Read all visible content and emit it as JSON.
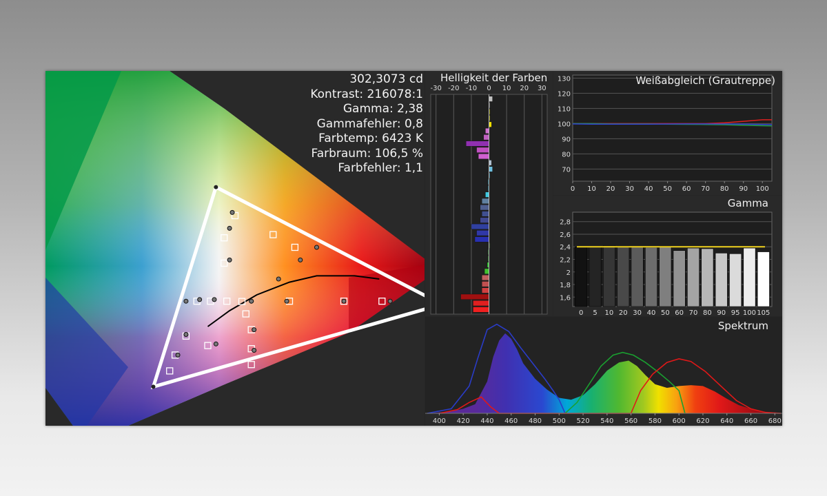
{
  "stats": {
    "luminance": "302,3073 cd",
    "contrast": "Kontrast: 216078:1",
    "gamma": "Gamma: 2,38",
    "gamma_error": "Gammafehler: 0,8",
    "color_temp": "Farbtemp: 6423 K",
    "gamut": "Farbraum: 106,5 %",
    "color_error": "Farbfehler: 1,1"
  },
  "colors": {
    "gamma_target": "#f0d21e",
    "wb_red": "#e02020",
    "wb_green": "#20a040",
    "wb_blue": "#3040d0",
    "spec_blue": "#2a3cc8",
    "spec_green": "#1aa030",
    "spec_red": "#e01818"
  },
  "chart_data": [
    {
      "type": "scatter",
      "name": "cie_gamut",
      "measured_primaries": [
        [
          0.68,
          0.32
        ],
        [
          0.265,
          0.69
        ],
        [
          0.15,
          0.06
        ]
      ],
      "reference_triangle": [
        [
          0.64,
          0.33
        ],
        [
          0.3,
          0.6
        ],
        [
          0.15,
          0.06
        ]
      ],
      "planckian_locus": [
        [
          0.565,
          0.4
        ],
        [
          0.52,
          0.41
        ],
        [
          0.45,
          0.41
        ],
        [
          0.4,
          0.39
        ],
        [
          0.34,
          0.35
        ],
        [
          0.29,
          0.3
        ],
        [
          0.25,
          0.25
        ]
      ],
      "targets": [
        [
          0.3,
          0.6
        ],
        [
          0.28,
          0.53
        ],
        [
          0.28,
          0.45
        ],
        [
          0.3127,
          0.329
        ],
        [
          0.4,
          0.33
        ],
        [
          0.5,
          0.33
        ],
        [
          0.57,
          0.33
        ],
        [
          0.41,
          0.5
        ],
        [
          0.37,
          0.54
        ],
        [
          0.23,
          0.33
        ],
        [
          0.255,
          0.33
        ],
        [
          0.285,
          0.33
        ],
        [
          0.19,
          0.16
        ],
        [
          0.21,
          0.22
        ],
        [
          0.25,
          0.19
        ],
        [
          0.32,
          0.29
        ],
        [
          0.33,
          0.24
        ],
        [
          0.33,
          0.18
        ],
        [
          0.33,
          0.13
        ],
        [
          0.18,
          0.11
        ]
      ],
      "measurements": [
        [
          0.295,
          0.61
        ],
        [
          0.29,
          0.56
        ],
        [
          0.29,
          0.46
        ],
        [
          0.33,
          0.33
        ],
        [
          0.38,
          0.4
        ],
        [
          0.42,
          0.46
        ],
        [
          0.45,
          0.5
        ],
        [
          0.395,
          0.33
        ],
        [
          0.5,
          0.33
        ],
        [
          0.585,
          0.33
        ],
        [
          0.21,
          0.33
        ],
        [
          0.235,
          0.335
        ],
        [
          0.262,
          0.335
        ],
        [
          0.195,
          0.16
        ],
        [
          0.21,
          0.225
        ],
        [
          0.265,
          0.195
        ],
        [
          0.33,
          0.33
        ],
        [
          0.335,
          0.24
        ],
        [
          0.335,
          0.175
        ]
      ]
    },
    {
      "type": "bar",
      "name": "helligkeit_der_farben",
      "title": "Helligkeit der Farben",
      "xticks": [
        -30,
        -20,
        -10,
        0,
        10,
        20,
        30
      ],
      "xlim": [
        -33,
        33
      ],
      "bars": [
        {
          "value": 2,
          "color": "#c0c0c0"
        },
        {
          "value": 0.5,
          "color": "#a8a8a8"
        },
        {
          "value": 0.5,
          "color": "#c8c800"
        },
        {
          "value": 0.5,
          "color": "#e0e000"
        },
        {
          "value": 1.5,
          "color": "#f0e000"
        },
        {
          "value": -2,
          "color": "#d070d0"
        },
        {
          "value": -3,
          "color": "#c060c0"
        },
        {
          "value": -13,
          "color": "#9030b0"
        },
        {
          "value": -7,
          "color": "#c050c0"
        },
        {
          "value": -6,
          "color": "#d060d0"
        },
        {
          "value": 1.5,
          "color": "#b0c0d0"
        },
        {
          "value": 2,
          "color": "#70c0e0"
        },
        {
          "value": 0.5,
          "color": "#50b0d0"
        },
        {
          "value": -0.5,
          "color": "#30a0c0"
        },
        {
          "value": -0.5,
          "color": "#2090b0"
        },
        {
          "value": -2,
          "color": "#40c8e0"
        },
        {
          "value": -4,
          "color": "#6080a0"
        },
        {
          "value": -5,
          "color": "#506090"
        },
        {
          "value": -4,
          "color": "#405090"
        },
        {
          "value": -5,
          "color": "#404890"
        },
        {
          "value": -10,
          "color": "#3040a0"
        },
        {
          "value": -7,
          "color": "#3038a8"
        },
        {
          "value": -8,
          "color": "#2830b0"
        },
        {
          "value": 0.5,
          "color": "#508040"
        },
        {
          "value": -0.5,
          "color": "#40a040"
        },
        {
          "value": -0.5,
          "color": "#30b030"
        },
        {
          "value": -1,
          "color": "#30c030"
        },
        {
          "value": -2.5,
          "color": "#40c030"
        },
        {
          "value": -4,
          "color": "#c06060"
        },
        {
          "value": -4,
          "color": "#c05050"
        },
        {
          "value": -4,
          "color": "#d04040"
        },
        {
          "value": -16,
          "color": "#a01010"
        },
        {
          "value": -9,
          "color": "#e02020"
        },
        {
          "value": -9,
          "color": "#f02020"
        }
      ]
    },
    {
      "type": "line",
      "name": "weissabgleich",
      "title": "Weißabgleich (Grautreppe)",
      "x": [
        0,
        10,
        20,
        30,
        40,
        50,
        60,
        70,
        80,
        90,
        100,
        105
      ],
      "xlim": [
        0,
        105
      ],
      "ylim": [
        62,
        132
      ],
      "yticks": [
        70,
        80,
        90,
        100,
        110,
        120,
        130
      ],
      "series": [
        {
          "name": "R",
          "color": "#e02020",
          "values": [
            100,
            100,
            100,
            100,
            100,
            100,
            100,
            100,
            100.5,
            101.5,
            102.5,
            102.5
          ]
        },
        {
          "name": "G",
          "color": "#20a040",
          "values": [
            100,
            100,
            99.8,
            99.8,
            99.8,
            99.6,
            99.5,
            99.4,
            99.2,
            98.9,
            98.6,
            98.5
          ]
        },
        {
          "name": "B",
          "color": "#3040d0",
          "values": [
            99.8,
            99.6,
            99.6,
            99.6,
            99.6,
            99.7,
            99.8,
            99.8,
            99.7,
            99.6,
            99.4,
            99.3
          ]
        }
      ]
    },
    {
      "type": "bar",
      "name": "gamma",
      "title": "Gamma",
      "categories": [
        "0",
        "5",
        "10",
        "20",
        "30",
        "40",
        "50",
        "60",
        "70",
        "80",
        "90",
        "95",
        "100",
        "105"
      ],
      "values": [
        2.4,
        2.4,
        2.42,
        2.41,
        2.4,
        2.39,
        2.41,
        2.34,
        2.38,
        2.37,
        2.3,
        2.29,
        2.38,
        2.32
      ],
      "target": 2.4,
      "ylim": [
        1.45,
        2.95
      ],
      "yticks": [
        "1,6",
        "1,8",
        "2",
        "2,2",
        "2,4",
        "2,6",
        "2,8"
      ],
      "ytick_values": [
        1.6,
        1.8,
        2.0,
        2.2,
        2.4,
        2.6,
        2.8
      ]
    },
    {
      "type": "area",
      "name": "spektrum",
      "title": "Spektrum",
      "xticks": [
        400,
        420,
        440,
        460,
        480,
        500,
        520,
        540,
        560,
        580,
        600,
        620,
        640,
        660,
        680
      ],
      "xlim": [
        390,
        685
      ],
      "ylim": [
        0,
        1
      ],
      "measured": [
        [
          390,
          0
        ],
        [
          400,
          0.01
        ],
        [
          410,
          0.02
        ],
        [
          420,
          0.05
        ],
        [
          430,
          0.1
        ],
        [
          440,
          0.35
        ],
        [
          445,
          0.62
        ],
        [
          450,
          0.8
        ],
        [
          455,
          0.88
        ],
        [
          460,
          0.82
        ],
        [
          465,
          0.7
        ],
        [
          470,
          0.55
        ],
        [
          480,
          0.38
        ],
        [
          490,
          0.26
        ],
        [
          500,
          0.17
        ],
        [
          510,
          0.15
        ],
        [
          520,
          0.2
        ],
        [
          530,
          0.32
        ],
        [
          540,
          0.47
        ],
        [
          550,
          0.56
        ],
        [
          558,
          0.58
        ],
        [
          565,
          0.52
        ],
        [
          572,
          0.42
        ],
        [
          580,
          0.32
        ],
        [
          590,
          0.28
        ],
        [
          600,
          0.3
        ],
        [
          610,
          0.31
        ],
        [
          620,
          0.3
        ],
        [
          630,
          0.24
        ],
        [
          640,
          0.16
        ],
        [
          650,
          0.09
        ],
        [
          660,
          0.05
        ],
        [
          670,
          0.02
        ],
        [
          680,
          0.01
        ],
        [
          685,
          0
        ]
      ],
      "reference": [
        {
          "name": "B",
          "color": "#2a3cc8",
          "points": [
            [
              390,
              0.0
            ],
            [
              410,
              0.05
            ],
            [
              425,
              0.3
            ],
            [
              432,
              0.6
            ],
            [
              440,
              0.92
            ],
            [
              448,
              0.98
            ],
            [
              458,
              0.9
            ],
            [
              468,
              0.72
            ],
            [
              478,
              0.55
            ],
            [
              488,
              0.38
            ],
            [
              495,
              0.25
            ],
            [
              500,
              0.15
            ],
            [
              505,
              0.0
            ]
          ]
        },
        {
          "name": "G",
          "color": "#1aa030",
          "points": [
            [
              505,
              0.0
            ],
            [
              515,
              0.12
            ],
            [
              525,
              0.32
            ],
            [
              535,
              0.52
            ],
            [
              545,
              0.64
            ],
            [
              553,
              0.67
            ],
            [
              562,
              0.64
            ],
            [
              572,
              0.56
            ],
            [
              582,
              0.46
            ],
            [
              592,
              0.35
            ],
            [
              600,
              0.25
            ],
            [
              605,
              0.0
            ]
          ]
        },
        {
          "name": "R",
          "color": "#e01818",
          "points": [
            [
              400,
              0.0
            ],
            [
              415,
              0.04
            ],
            [
              425,
              0.12
            ],
            [
              435,
              0.18
            ],
            [
              443,
              0.07
            ],
            [
              450,
              0.0
            ],
            [
              560,
              0.0
            ],
            [
              568,
              0.25
            ],
            [
              578,
              0.43
            ],
            [
              590,
              0.56
            ],
            [
              600,
              0.6
            ],
            [
              610,
              0.57
            ],
            [
              622,
              0.46
            ],
            [
              635,
              0.3
            ],
            [
              648,
              0.14
            ],
            [
              660,
              0.05
            ],
            [
              672,
              0.01
            ],
            [
              685,
              0.0
            ]
          ]
        }
      ]
    }
  ]
}
